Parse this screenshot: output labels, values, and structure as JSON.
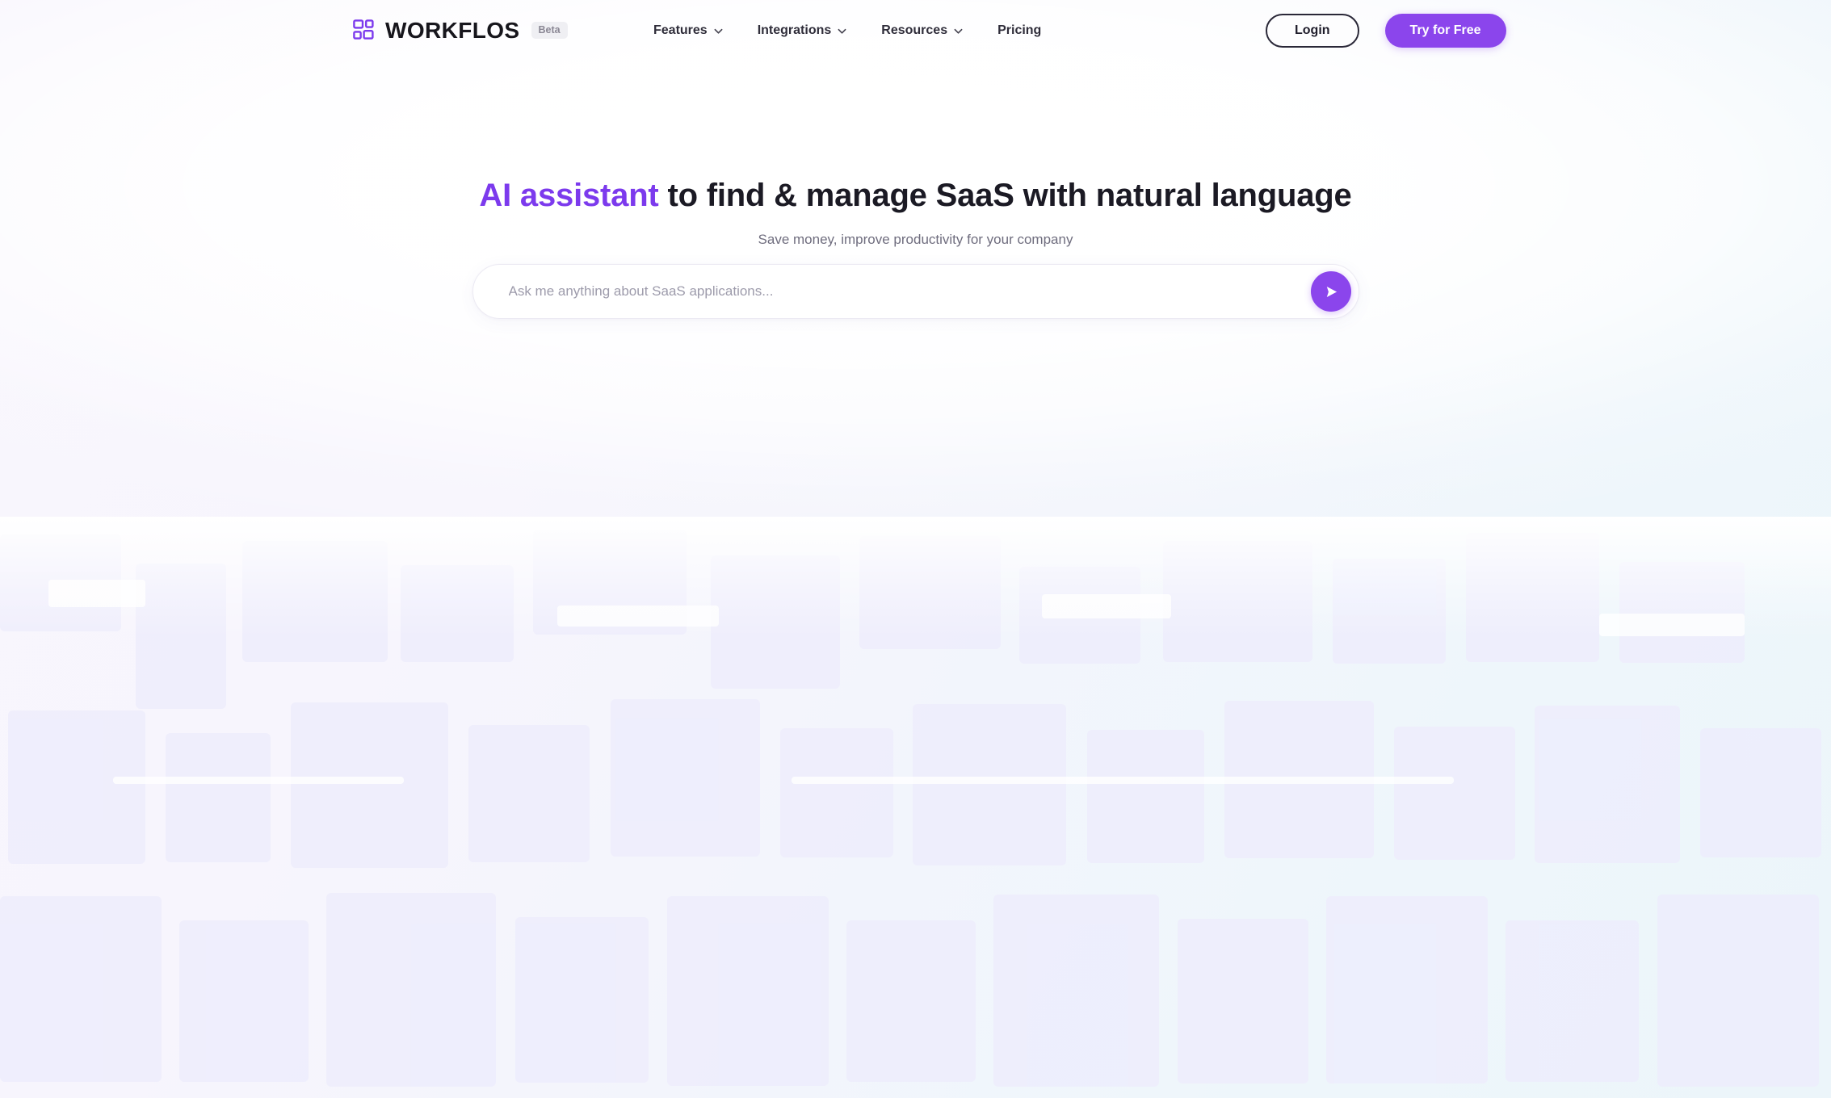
{
  "header": {
    "brand_name": "WORKFLOS",
    "beta_badge": "Beta",
    "logo_icon": "grid-squares-icon",
    "nav": [
      {
        "label": "Features",
        "has_dropdown": true,
        "icon": "chevron-down-icon"
      },
      {
        "label": "Integrations",
        "has_dropdown": true,
        "icon": "chevron-down-icon"
      },
      {
        "label": "Resources",
        "has_dropdown": true,
        "icon": "chevron-down-icon"
      },
      {
        "label": "Pricing",
        "has_dropdown": false,
        "icon": ""
      }
    ],
    "login_label": "Login",
    "try_free_label": "Try for Free"
  },
  "hero": {
    "headline_accent": "AI assistant",
    "headline_rest": " to find & manage SaaS with natural language",
    "subheadline": "Save money, improve productivity for your company"
  },
  "search": {
    "placeholder": "Ask me anything about SaaS applications...",
    "value": "",
    "submit_icon": "send-arrow-icon"
  },
  "colors": {
    "accent_purple": "#8b45ec",
    "headline_accent": "#7c3aed",
    "text_dark": "#1b1a24",
    "text_muted": "#6f6d7e",
    "placeholder": "#9d9bab",
    "page_bg_left": "#f7f5fd",
    "page_bg_right": "#ecf5fa",
    "badge_bg": "#efeff3"
  }
}
